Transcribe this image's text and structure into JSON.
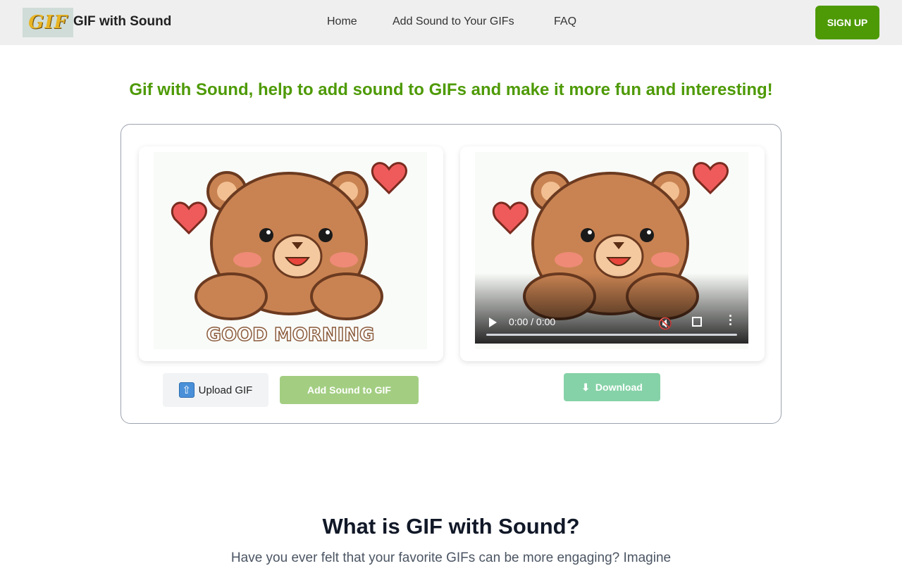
{
  "header": {
    "logo_text": "GIF",
    "brand": "GIF with Sound",
    "nav": [
      "Home",
      "Add Sound to Your GIFs",
      "FAQ"
    ],
    "signup": "SIGN UP"
  },
  "hero": {
    "headline": "Gif with Sound, help to add sound to GIFs and make it more fun and interesting!"
  },
  "editor": {
    "gif_caption": "GOOD MORNING",
    "upload_label": "Upload GIF",
    "add_sound_label": "Add Sound to GIF",
    "download_label": "Download",
    "video_time": "0:00 / 0:00"
  },
  "about": {
    "title": "What is GIF with Sound?",
    "text": "Have you ever felt that your favorite GIFs can be more engaging? Imagine"
  },
  "colors": {
    "accent": "#4e9a06",
    "add_sound_button": "#a3ce82",
    "download_button": "#86d2a8"
  },
  "icons": {
    "upload": "upload-arrow-icon",
    "download": "download-arrow-icon",
    "play": "play-icon",
    "mute": "mute-icon",
    "fullscreen": "fullscreen-icon",
    "more": "more-options-icon"
  }
}
